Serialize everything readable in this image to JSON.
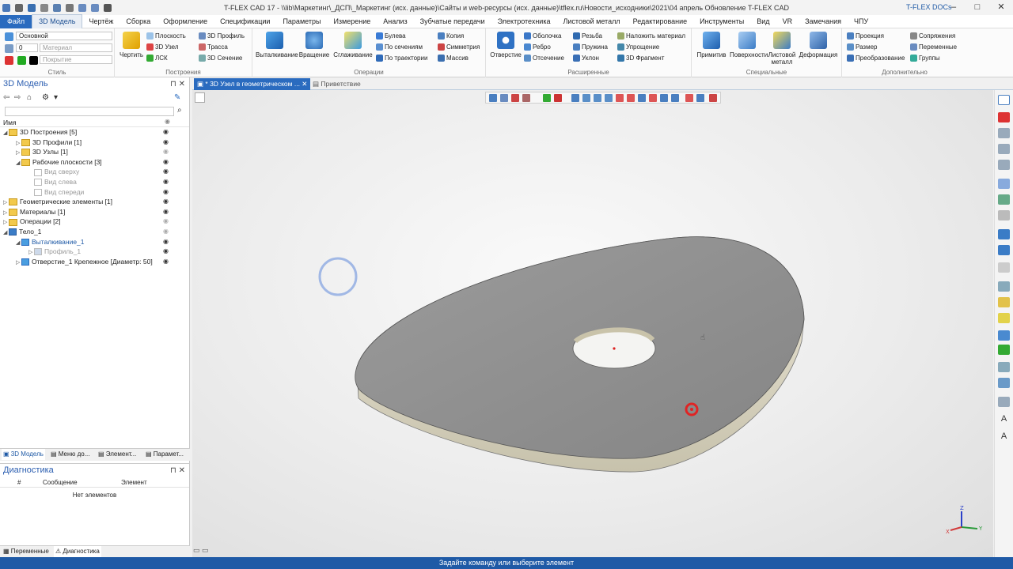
{
  "window": {
    "title": "T-FLEX CAD 17 - \\\\lib\\Маркетинг\\_ДСП\\_Маркетинг (исх. данные)\\Сайты и web-ресурсы (исх. данные)\\tflex.ru\\Новости_исходники\\2021\\04 апрель Обновление T-FLEX CAD",
    "docs_label": "T-FLEX DOCs"
  },
  "menu": [
    "Файл",
    "3D Модель",
    "Чертёж",
    "Сборка",
    "Оформление",
    "Спецификации",
    "Параметры",
    "Измерение",
    "Анализ",
    "Зубчатые передачи",
    "Электротехника",
    "Листовой металл",
    "Редактирование",
    "Инструменты",
    "Вид",
    "VR",
    "Замечания",
    "ЧПУ"
  ],
  "ribbon": {
    "style": {
      "label": "Стиль",
      "layer": "Основной",
      "level": "0",
      "material": "Материал",
      "coating": "Покрытие"
    },
    "build": {
      "label": "Построения",
      "draw": "Чертить",
      "plane": "Плоскость",
      "node3d": "3D Узел",
      "lsk": "ЛСК",
      "profile3d": "3D Профиль",
      "track": "Трасса",
      "section3d": "3D Сечение"
    },
    "ops": {
      "label": "Операции",
      "extrude": "Выталкивание",
      "rotate": "Вращение",
      "smooth": "Сглаживание",
      "boolean": "Булева",
      "by_sections": "По сечениям",
      "by_path": "По траектории",
      "copy": "Копия",
      "symmetry": "Симметрия",
      "array": "Массив"
    },
    "ext": {
      "label": "Расширенные",
      "hole": "Отверстие",
      "shell": "Оболочка",
      "rib": "Ребро",
      "cut": "Отсечение",
      "thread": "Резьба",
      "spring": "Пружина",
      "slope": "Уклон",
      "apply_material": "Наложить материал",
      "simplify": "Упрощение",
      "fragment3d": "3D Фрагмент"
    },
    "special": {
      "label": "Специальные",
      "primitive": "Примитив",
      "surfaces": "Поверхности",
      "sheet": "Листовой металл",
      "deform": "Деформация"
    },
    "extra": {
      "label": "Дополнительно",
      "projection": "Проекция",
      "size": "Размер",
      "transform": "Преобразование",
      "mates": "Сопряжения",
      "variables": "Переменные",
      "groups": "Группы"
    }
  },
  "model_panel": {
    "title": "3D Модель",
    "column": "Имя",
    "tree": [
      {
        "label": "3D Построения [5]",
        "level": 0,
        "exp": "◢",
        "icon": "folder"
      },
      {
        "label": "3D Профили [1]",
        "level": 1,
        "exp": "▷",
        "icon": "folder"
      },
      {
        "label": "3D Узлы [1]",
        "level": 1,
        "exp": "▷",
        "icon": "folder"
      },
      {
        "label": "Рабочие плоскости [3]",
        "level": 1,
        "exp": "◢",
        "icon": "folder"
      },
      {
        "label": "Вид сверху",
        "level": 2,
        "exp": "",
        "icon": "plane"
      },
      {
        "label": "Вид слева",
        "level": 2,
        "exp": "",
        "icon": "plane"
      },
      {
        "label": "Вид спереди",
        "level": 2,
        "exp": "",
        "icon": "plane"
      },
      {
        "label": "Геометрические элементы [1]",
        "level": 0,
        "exp": "▷",
        "icon": "folder"
      },
      {
        "label": "Материалы [1]",
        "level": 0,
        "exp": "▷",
        "icon": "folder"
      },
      {
        "label": "Операции [2]",
        "level": 0,
        "exp": "▷",
        "icon": "folder"
      },
      {
        "label": "Тело_1",
        "level": 0,
        "exp": "◢",
        "icon": "body"
      },
      {
        "label": "Выталкивание_1",
        "level": 1,
        "exp": "◢",
        "icon": "op"
      },
      {
        "label": "Профиль_1",
        "level": 2,
        "exp": "▷",
        "icon": "profile"
      },
      {
        "label": "Отверстие_1 Крепежное [Диаметр: 50]",
        "level": 1,
        "exp": "▷",
        "icon": "op"
      }
    ],
    "tabs": [
      "3D Модель",
      "Меню до...",
      "Элемент...",
      "Парамет..."
    ]
  },
  "diagnostics": {
    "title": "Диагностика",
    "col_num": "#",
    "col_msg": "Сообщение",
    "col_elem": "Элемент",
    "empty": "Нет элементов",
    "tabs": [
      "Переменные",
      "Диагностика"
    ]
  },
  "doc_tabs": [
    "* 3D Узел в геометрическом ...",
    "Приветствие"
  ],
  "status": "Задайте команду или выберите элемент",
  "colors": {
    "accent": "#2a6bbf",
    "part_top": "#8f8f8f",
    "part_edge": "#ddd9c4",
    "marker": "#e03030"
  }
}
